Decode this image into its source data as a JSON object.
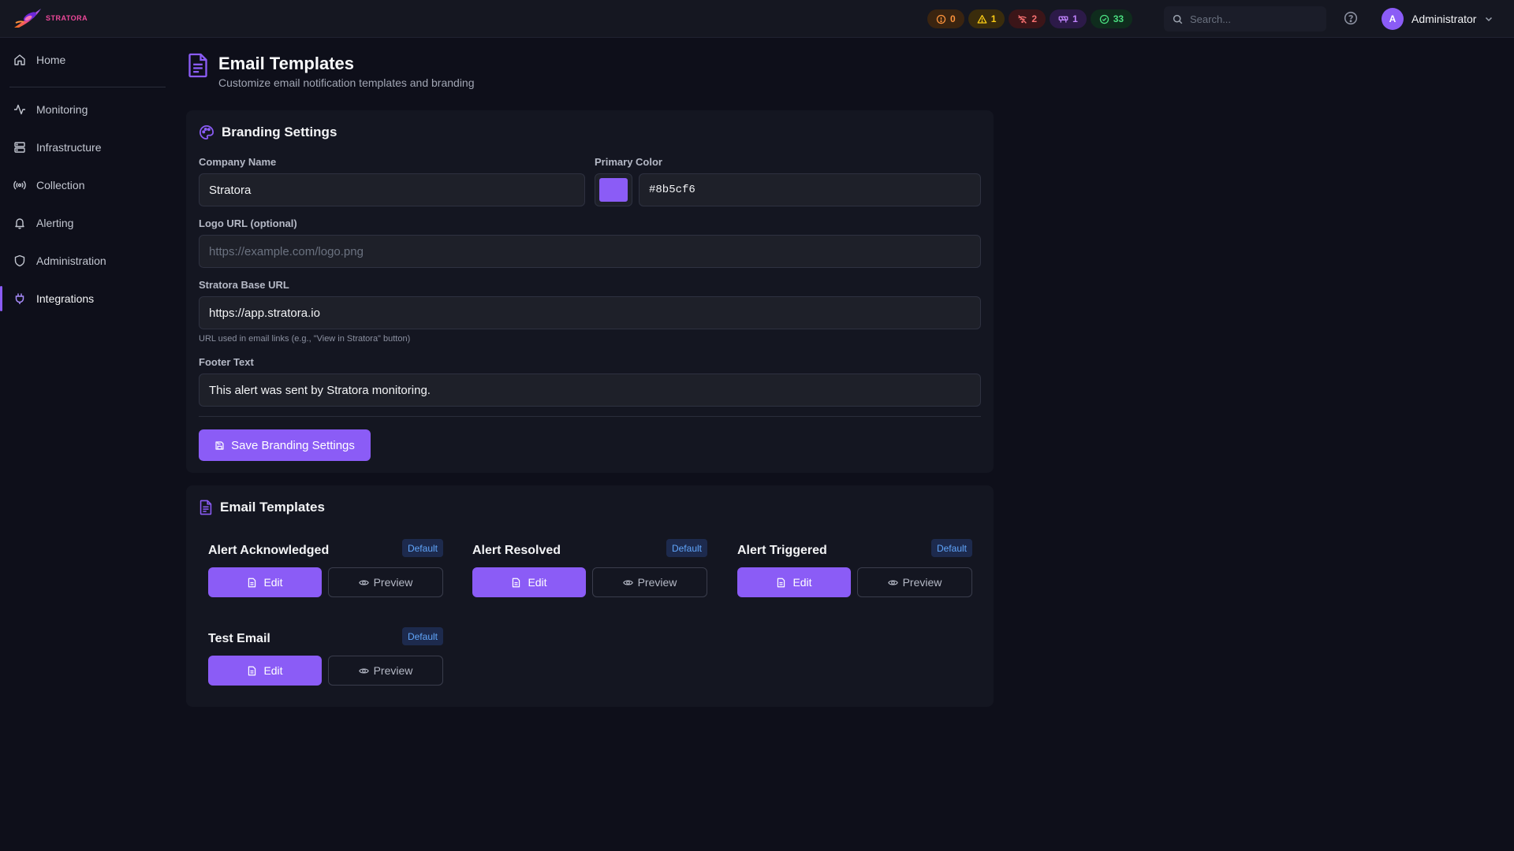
{
  "app": {
    "logo_text": "STRATORA"
  },
  "status": [
    {
      "key": "critical",
      "count": "0",
      "icon": "alert-circle-icon",
      "color": "#fb923c"
    },
    {
      "key": "warning",
      "count": "1",
      "icon": "alert-triangle-icon",
      "color": "#facc15"
    },
    {
      "key": "down",
      "count": "2",
      "icon": "wifi-off-icon",
      "color": "#f87171"
    },
    {
      "key": "maintenance",
      "count": "1",
      "icon": "construction-icon",
      "color": "#c084fc"
    },
    {
      "key": "ok",
      "count": "33",
      "icon": "check-circle-icon",
      "color": "#4ade80"
    }
  ],
  "search": {
    "placeholder": "Search..."
  },
  "user": {
    "initial": "A",
    "name": "Administrator"
  },
  "sidebar": {
    "items": [
      {
        "label": "Home",
        "icon": "home-icon"
      },
      {
        "label": "Monitoring",
        "icon": "activity-icon"
      },
      {
        "label": "Infrastructure",
        "icon": "server-icon"
      },
      {
        "label": "Collection",
        "icon": "radio-icon"
      },
      {
        "label": "Alerting",
        "icon": "bell-icon"
      },
      {
        "label": "Administration",
        "icon": "shield-icon"
      },
      {
        "label": "Integrations",
        "icon": "plug-icon",
        "active": true
      }
    ]
  },
  "page": {
    "title": "Email Templates",
    "subtitle": "Customize email notification templates and branding"
  },
  "branding": {
    "title": "Branding Settings",
    "company_name_label": "Company Name",
    "company_name_value": "Stratora",
    "primary_color_label": "Primary Color",
    "primary_color_value": "#8b5cf6",
    "logo_url_label": "Logo URL (optional)",
    "logo_url_placeholder": "https://example.com/logo.png",
    "base_url_label": "Stratora Base URL",
    "base_url_value": "https://app.stratora.io",
    "base_url_help": "URL used in email links (e.g., \"View in Stratora\" button)",
    "footer_label": "Footer Text",
    "footer_value": "This alert was sent by Stratora monitoring.",
    "save_label": "Save Branding Settings"
  },
  "templates": {
    "title": "Email Templates",
    "edit_label": "Edit",
    "preview_label": "Preview",
    "items": [
      {
        "name": "Alert Acknowledged",
        "badge": "Default"
      },
      {
        "name": "Alert Resolved",
        "badge": "Default"
      },
      {
        "name": "Alert Triggered",
        "badge": "Default"
      },
      {
        "name": "Test Email",
        "badge": "Default"
      }
    ]
  },
  "colors": {
    "accent": "#8b5cf6",
    "background": "#0e0f1a",
    "card": "#141621",
    "badge_text": "#60a5fa"
  }
}
